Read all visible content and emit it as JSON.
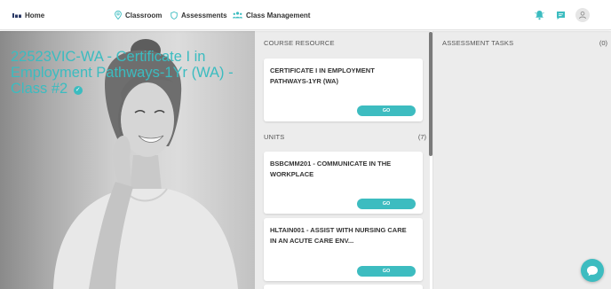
{
  "nav": {
    "home": "Home",
    "classroom": "Classroom",
    "assessments": "Assessments",
    "class_management": "Class Management"
  },
  "hero": {
    "title": "22523VIC-WA - Certificate I in Employment Pathways-1Yr (WA) - Class #2"
  },
  "course_resource": {
    "heading": "COURSE RESOURCE",
    "card_title": "CERTIFICATE I IN EMPLOYMENT PATHWAYS-1YR (WA)",
    "button": "GO"
  },
  "units": {
    "heading": "UNITS",
    "count": "(7)",
    "items": [
      {
        "title": "BSBCMM201 - COMMUNICATE IN THE WORKPLACE",
        "button": "GO"
      },
      {
        "title": "HLTAIN001 - ASSIST WITH NURSING CARE IN AN ACUTE CARE ENV...",
        "button": "GO"
      }
    ]
  },
  "assessment_tasks": {
    "heading": "ASSESSMENT TASKS",
    "count": "(0)"
  },
  "colors": {
    "accent": "#3dbcc0",
    "panel_bg": "#ececec"
  },
  "icons": [
    "home-icon",
    "map-pin-icon",
    "shield-icon",
    "users-icon",
    "bell-icon",
    "chat-icon",
    "user-avatar-icon",
    "chat-bubble-icon",
    "verified-check-icon"
  ]
}
